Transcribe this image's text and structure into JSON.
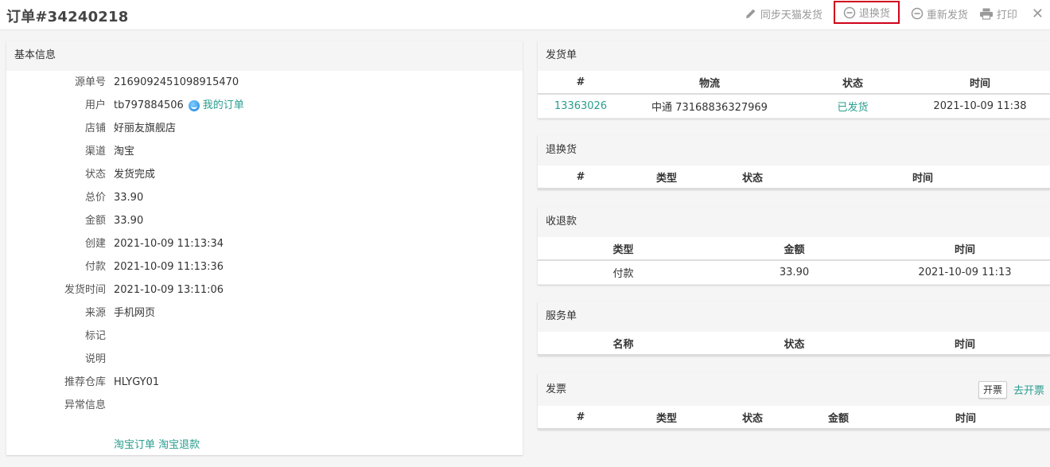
{
  "header": {
    "title": "订单#34240218",
    "actions": {
      "sync": "同步天猫发货",
      "return_exchange": "退换货",
      "reship": "重新发货",
      "print": "打印",
      "close": "✕"
    }
  },
  "basic": {
    "title": "基本信息",
    "rows": [
      {
        "k": "源单号",
        "v": "2169092451098915470"
      },
      {
        "k": "用户",
        "v": "tb797884506",
        "link": "我的订单"
      },
      {
        "k": "店铺",
        "v": "好丽友旗舰店"
      },
      {
        "k": "渠道",
        "v": "淘宝"
      },
      {
        "k": "状态",
        "v": "发货完成"
      },
      {
        "k": "总价",
        "v": "33.90"
      },
      {
        "k": "金额",
        "v": "33.90"
      },
      {
        "k": "创建",
        "v": "2021-10-09 11:13:34"
      },
      {
        "k": "付款",
        "v": "2021-10-09 11:13:36"
      },
      {
        "k": "发货时间",
        "v": "2021-10-09 13:11:06"
      },
      {
        "k": "来源",
        "v": "手机网页"
      },
      {
        "k": "标记",
        "v": ""
      },
      {
        "k": "说明",
        "v": ""
      },
      {
        "k": "推荐仓库",
        "v": "HLYGY01"
      },
      {
        "k": "异常信息",
        "v": ""
      }
    ],
    "bottom_links": [
      "淘宝订单",
      "淘宝退款"
    ]
  },
  "shipments": {
    "title": "发货单",
    "headers": [
      "#",
      "物流",
      "状态",
      "时间"
    ],
    "rows": [
      [
        "13363026",
        "中通 73168836327969",
        "已发货",
        "2021-10-09 11:38"
      ]
    ]
  },
  "returns": {
    "title": "退换货",
    "headers": [
      "#",
      "类型",
      "状态",
      "时间"
    ]
  },
  "payments": {
    "title": "收退款",
    "headers": [
      "类型",
      "金额",
      "时间"
    ],
    "rows": [
      [
        "付款",
        "33.90",
        "2021-10-09 11:13"
      ]
    ]
  },
  "services": {
    "title": "服务单",
    "headers": [
      "名称",
      "状态",
      "时间"
    ]
  },
  "invoice": {
    "title": "发票",
    "open_button": "开票",
    "go_link": "去开票",
    "headers": [
      "#",
      "类型",
      "状态",
      "金额",
      "时间"
    ]
  }
}
